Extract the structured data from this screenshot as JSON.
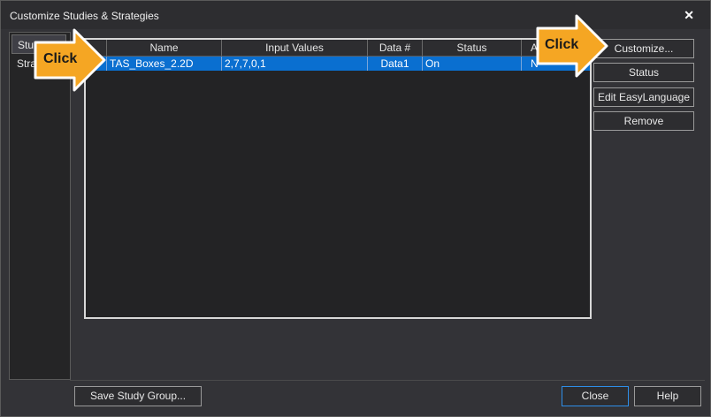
{
  "window": {
    "title": "Customize Studies & Strategies",
    "close_glyph": "✕"
  },
  "tabs": [
    {
      "label": "Studies",
      "active": true
    },
    {
      "label": "Strategies",
      "active": false
    }
  ],
  "table": {
    "columns": [
      "",
      "Name",
      "Input Values",
      "Data #",
      "Status",
      "A"
    ],
    "rows": [
      {
        "check": "",
        "name": "TAS_Boxes_2.2D",
        "inputs": "2,7,7,0,1",
        "data": "Data1",
        "status": "On",
        "a": "N"
      }
    ]
  },
  "side_buttons": {
    "customize": "Customize...",
    "status": "Status",
    "edit": "Edit EasyLanguage",
    "remove": "Remove"
  },
  "bottom_buttons": {
    "save_group": "Save Study Group...",
    "close": "Close",
    "help": "Help"
  },
  "callouts": {
    "left": "Click",
    "right": "Click"
  },
  "colors": {
    "selection": "#0a6fd0",
    "callout": "#f5a623",
    "primary_border": "#2e8ee8"
  }
}
